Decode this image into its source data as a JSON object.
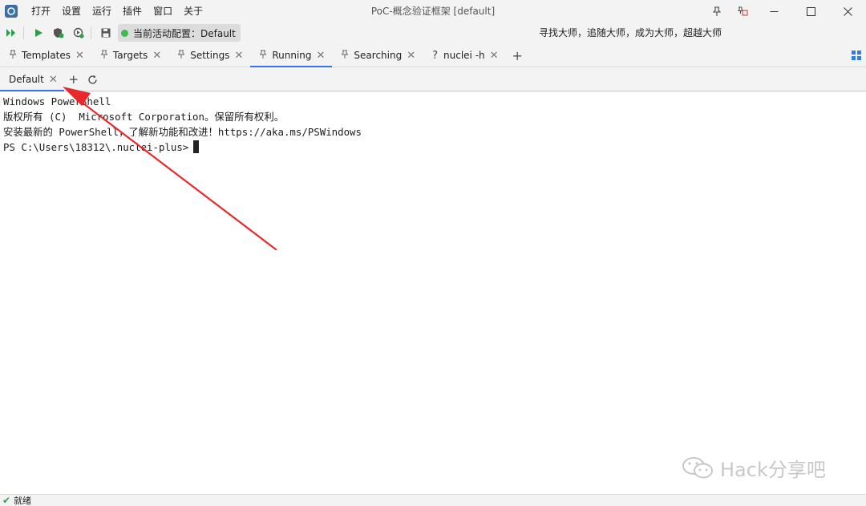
{
  "window": {
    "title": "PoC-概念验证框架 [default]",
    "menu": [
      "打开",
      "设置",
      "运行",
      "插件",
      "窗口",
      "关于"
    ]
  },
  "toolbar": {
    "active_config_label": "当前活动配置：Default",
    "slogan": "寻找大师，追随大师，成为大师，超越大师",
    "icons": [
      "run-all-icon",
      "run-icon",
      "stop-shield-icon",
      "rerun-icon",
      "save-icon"
    ]
  },
  "tabs": [
    {
      "label": "Templates",
      "icon": "pin-icon"
    },
    {
      "label": "Targets",
      "icon": "pin-icon"
    },
    {
      "label": "Settings",
      "icon": "pin-icon"
    },
    {
      "label": "Running",
      "icon": "pin-icon",
      "active": true
    },
    {
      "label": "Searching",
      "icon": "pin-icon"
    },
    {
      "label": "nuclei -h",
      "icon": "help-icon"
    }
  ],
  "terminal_tabs": [
    {
      "label": "Default",
      "active": true
    }
  ],
  "terminal": {
    "lines": [
      "Windows PowerShell",
      "版权所有 (C)  Microsoft Corporation。保留所有权利。",
      "安装最新的 PowerShell，了解新功能和改进！https://aka.ms/PSWindows",
      "PS C:\\Users\\18312\\.nuclei-plus>"
    ]
  },
  "status": {
    "text": "就绪"
  },
  "watermark": {
    "text": "Hack分享吧"
  },
  "colors": {
    "accent": "#3574f0",
    "annotation_arrow": "#e8282b",
    "status_ok": "#2e9e49"
  }
}
